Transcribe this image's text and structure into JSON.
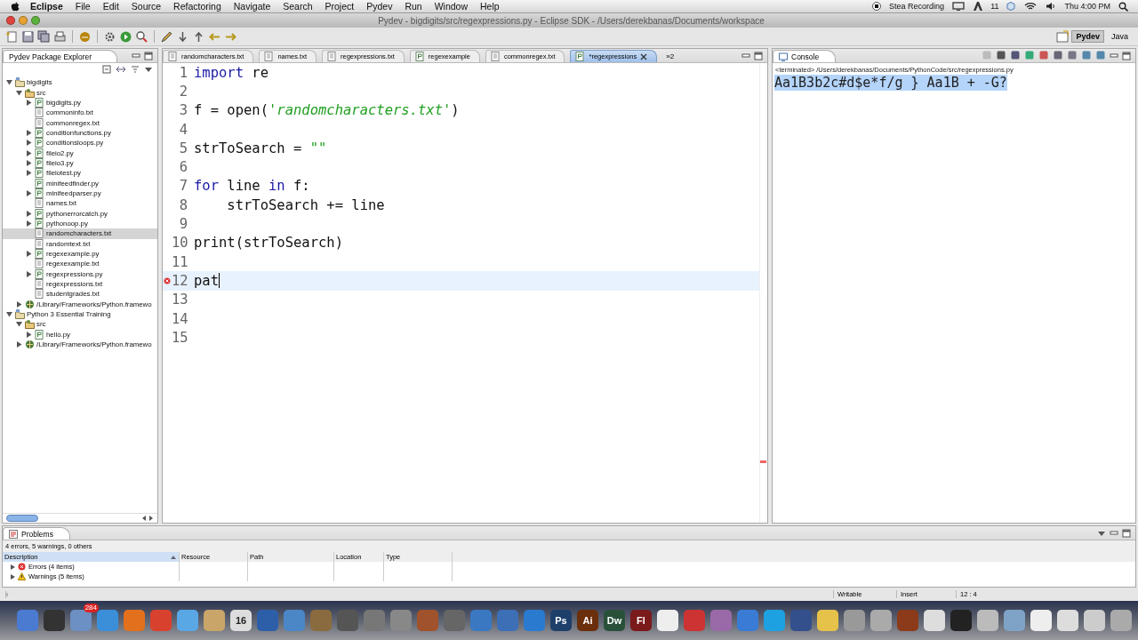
{
  "menubar": {
    "app": "Eclipse",
    "menus": [
      "File",
      "Edit",
      "Source",
      "Refactoring",
      "Navigate",
      "Search",
      "Project",
      "Pydev",
      "Run",
      "Window",
      "Help"
    ],
    "recording": "Stea Recording",
    "badge_count": "11",
    "clock": "Thu 4:00 PM"
  },
  "window": {
    "title": "Pydev - bigdigits/src/regexpressions.py - Eclipse SDK - /Users/derekbanas/Documents/workspace"
  },
  "perspectives": [
    {
      "label": "Pydev",
      "selected": true
    },
    {
      "label": "Java",
      "selected": false
    }
  ],
  "explorer": {
    "title": "Pydev Package Explorer",
    "tree": [
      {
        "label": "bigdigits",
        "kind": "project",
        "expanded": true,
        "selected": false,
        "children": [
          {
            "label": "src",
            "kind": "package",
            "expanded": true,
            "selected": false,
            "children": [
              {
                "label": "bigdigits.py",
                "kind": "py",
                "expanded": false,
                "selected": false
              },
              {
                "label": "commoninfo.txt",
                "kind": "txt",
                "selected": false
              },
              {
                "label": "commonregex.txt",
                "kind": "txt",
                "selected": false
              },
              {
                "label": "conditionfunctions.py",
                "kind": "py",
                "expanded": false,
                "selected": false
              },
              {
                "label": "conditionsloops.py",
                "kind": "py",
                "expanded": false,
                "selected": false
              },
              {
                "label": "fileio2.py",
                "kind": "py",
                "expanded": false,
                "selected": false
              },
              {
                "label": "fileio3.py",
                "kind": "py",
                "expanded": false,
                "selected": false
              },
              {
                "label": "fileiotest.py",
                "kind": "py",
                "expanded": false,
                "selected": false
              },
              {
                "label": "minifeedfinder.py",
                "kind": "py",
                "selected": false
              },
              {
                "label": "minifeedparser.py",
                "kind": "py",
                "expanded": false,
                "selected": false
              },
              {
                "label": "names.txt",
                "kind": "txt",
                "selected": false
              },
              {
                "label": "pythonerrorcatch.py",
                "kind": "py",
                "expanded": false,
                "selected": false
              },
              {
                "label": "pythonoop.py",
                "kind": "py",
                "expanded": false,
                "selected": false
              },
              {
                "label": "randomcharacters.txt",
                "kind": "txt",
                "selected": true
              },
              {
                "label": "randomtext.txt",
                "kind": "txt",
                "selected": false
              },
              {
                "label": "regexexample.py",
                "kind": "py",
                "expanded": false,
                "selected": false
              },
              {
                "label": "regexexample.txt",
                "kind": "txt",
                "selected": false
              },
              {
                "label": "regexpressions.py",
                "kind": "py",
                "expanded": false,
                "selected": false
              },
              {
                "label": "regexpressions.txt",
                "kind": "txt",
                "selected": false
              },
              {
                "label": "studentgrades.txt",
                "kind": "txt",
                "selected": false
              }
            ]
          },
          {
            "label": "/Library/Frameworks/Python.framewo",
            "kind": "lib",
            "expanded": false,
            "selected": false
          }
        ]
      },
      {
        "label": "Python 3 Essential Training",
        "kind": "project",
        "expanded": true,
        "selected": false,
        "children": [
          {
            "label": "src",
            "kind": "package",
            "expanded": true,
            "selected": false,
            "children": [
              {
                "label": "hello.py",
                "kind": "py",
                "expanded": false,
                "selected": false
              }
            ]
          },
          {
            "label": "/Library/Frameworks/Python.framewo",
            "kind": "lib",
            "expanded": false,
            "selected": false
          }
        ]
      }
    ]
  },
  "editor": {
    "tabs": [
      {
        "label": "randomcharacters.txt",
        "kind": "txt",
        "selected": false
      },
      {
        "label": "names.txt",
        "kind": "txt",
        "selected": false
      },
      {
        "label": "regexpressions.txt",
        "kind": "txt",
        "selected": false
      },
      {
        "label": "regexexample",
        "kind": "py",
        "selected": false
      },
      {
        "label": "commonregex.txt",
        "kind": "txt",
        "selected": false
      },
      {
        "label": "*regexpressions",
        "kind": "py",
        "selected": true
      }
    ],
    "overflow": "»2",
    "lines": [
      {
        "number": "1",
        "tokens": [
          {
            "kind": "keyword",
            "text": "import"
          },
          {
            "kind": "plain",
            "text": " re"
          }
        ]
      },
      {
        "number": "2"
      },
      {
        "number": "3",
        "tokens": [
          {
            "kind": "plain",
            "text": "f = open("
          },
          {
            "kind": "string",
            "text": "'randomcharacters.txt'"
          },
          {
            "kind": "plain",
            "text": ")"
          }
        ]
      },
      {
        "number": "4"
      },
      {
        "number": "5",
        "tokens": [
          {
            "kind": "plain",
            "text": "strToSearch = "
          },
          {
            "kind": "string",
            "text": "\"\""
          }
        ]
      },
      {
        "number": "6"
      },
      {
        "number": "7",
        "tokens": [
          {
            "kind": "keyword",
            "text": "for"
          },
          {
            "kind": "plain",
            "text": " line "
          },
          {
            "kind": "keyword",
            "text": "in"
          },
          {
            "kind": "plain",
            "text": " f:"
          }
        ]
      },
      {
        "number": "8",
        "tokens": [
          {
            "kind": "plain",
            "text": "    strToSearch += line"
          }
        ]
      },
      {
        "number": "9"
      },
      {
        "number": "10",
        "tokens": [
          {
            "kind": "plain",
            "text": "print(strToSearch)"
          }
        ]
      },
      {
        "number": "11"
      },
      {
        "number": "12",
        "current": true,
        "error": true,
        "tokens": [
          {
            "kind": "plain",
            "text": "pat"
          }
        ]
      },
      {
        "number": "13"
      },
      {
        "number": "14"
      },
      {
        "number": "15"
      }
    ]
  },
  "console": {
    "title": "Console",
    "status": "<terminated> /Users/derekbanas/Documents/PythonCode/src/regexpressions.py",
    "output": "Aa1B3b2c#d$e*f/g } Aa1B + -G?",
    "output_selected": true
  },
  "problems": {
    "title": "Problems",
    "summary": "4 errors, 5 warnings, 0 others",
    "columns": [
      "Description",
      "Resource",
      "Path",
      "Location",
      "Type"
    ],
    "rows": [
      {
        "label": "Errors (4 items)",
        "kind": "error",
        "expanded": false
      },
      {
        "label": "Warnings (5 items)",
        "kind": "warning",
        "expanded": false
      }
    ]
  },
  "status_bar": [
    "Writable",
    "Insert",
    "12 : 4"
  ],
  "dock": [
    {
      "color": "#4a7bd0"
    },
    {
      "color": "#333333"
    },
    {
      "color": "#6c8fc4",
      "badge": "284"
    },
    {
      "color": "#3b8fd8"
    },
    {
      "color": "#e2701c"
    },
    {
      "color": "#d9412f"
    },
    {
      "color": "#5aa7e6"
    },
    {
      "color": "#c9a56a"
    },
    {
      "color": "#dddddd",
      "label": "16"
    },
    {
      "color": "#2d5fa8"
    },
    {
      "color": "#4b87c6"
    },
    {
      "color": "#8a6b3f"
    },
    {
      "color": "#555555"
    },
    {
      "color": "#777777"
    },
    {
      "color": "#888888"
    },
    {
      "color": "#a0522d"
    },
    {
      "color": "#666666"
    },
    {
      "color": "#3a78c2"
    },
    {
      "color": "#3d6fb6"
    },
    {
      "color": "#2a7ad0"
    },
    {
      "color": "#1f3f6b",
      "label": "Ps"
    },
    {
      "color": "#6b2f0b",
      "label": "Ai"
    },
    {
      "color": "#29513a",
      "label": "Dw"
    },
    {
      "color": "#7a1a1a",
      "label": "Fl"
    },
    {
      "color": "#eeeeee"
    },
    {
      "color": "#cc3333"
    },
    {
      "color": "#9a6aa8"
    },
    {
      "color": "#3a7bd5"
    },
    {
      "color": "#1da1e0"
    },
    {
      "color": "#334f8c"
    },
    {
      "color": "#e6c24a"
    },
    {
      "color": "#999999"
    },
    {
      "color": "#aaaaaa"
    },
    {
      "color": "#8b3a1a"
    },
    {
      "color": "#dddddd"
    },
    {
      "color": "#222222"
    },
    {
      "color": "#bbbbbb"
    },
    {
      "color": "#7fa3c6"
    },
    {
      "color": "#eeeeee"
    },
    {
      "color": "#dddddd"
    },
    {
      "color": "#cccccc"
    },
    {
      "color": "#aaaaaa"
    }
  ]
}
